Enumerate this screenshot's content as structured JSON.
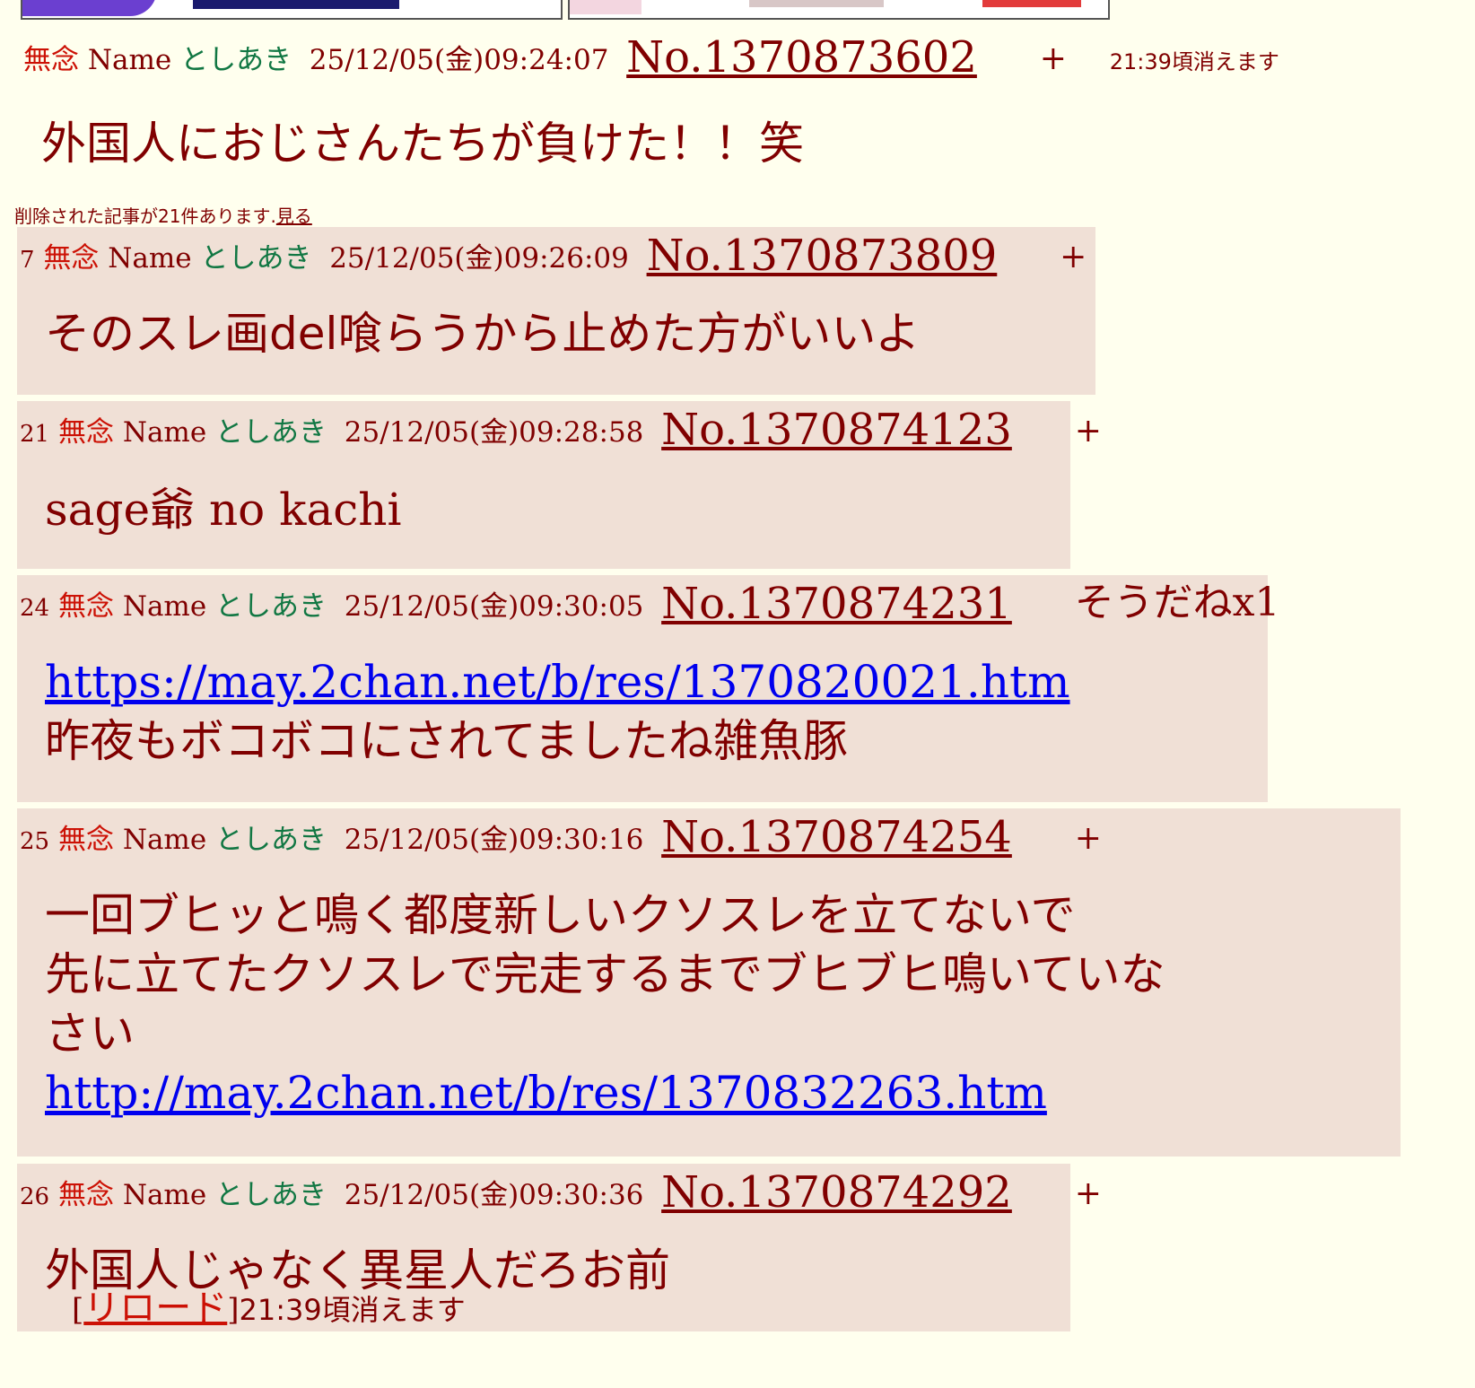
{
  "op": {
    "subject": "無念",
    "name_label": "Name",
    "name": "としあき",
    "datetime": "25/12/05(金)09:24:07",
    "post_no": "No.1370873602",
    "plus": "+",
    "expire_note": "21:39頃消えます",
    "body": "外国人におじさんたちが負けた！！笑"
  },
  "deleted_notice": {
    "text": "削除された記事が21件あります.",
    "link": "見る"
  },
  "replies": [
    {
      "res_num": "7",
      "subject": "無念",
      "name_label": "Name",
      "name": "としあき",
      "datetime": "25/12/05(金)09:26:09",
      "post_no": "No.1370873809",
      "plus": "+",
      "lines": [
        "そのスレ画del喰らうから止めた方がいいよ"
      ]
    },
    {
      "res_num": "21",
      "subject": "無念",
      "name_label": "Name",
      "name": "としあき",
      "datetime": "25/12/05(金)09:28:58",
      "post_no": "No.1370874123",
      "plus": "+",
      "lines": [
        "sage爺 no kachi"
      ]
    },
    {
      "res_num": "24",
      "subject": "無念",
      "name_label": "Name",
      "name": "としあき",
      "datetime": "25/12/05(金)09:30:05",
      "post_no": "No.1370874231",
      "soudane": "そうだねx1",
      "link1": "https://may.2chan.net/b/res/1370820021.htm",
      "lines": [
        "昨夜もボコボコにされてましたね雑魚豚"
      ]
    },
    {
      "res_num": "25",
      "subject": "無念",
      "name_label": "Name",
      "name": "としあき",
      "datetime": "25/12/05(金)09:30:16",
      "post_no": "No.1370874254",
      "plus": "+",
      "lines": [
        "一回ブヒッと鳴く都度新しいクソスレを立てないで",
        "先に立てたクソスレで完走するまでブヒブヒ鳴いていな",
        "さい"
      ],
      "link1": "http://may.2chan.net/b/res/1370832263.htm"
    },
    {
      "res_num": "26",
      "subject": "無念",
      "name_label": "Name",
      "name": "としあき",
      "datetime": "25/12/05(金)09:30:36",
      "post_no": "No.1370874292",
      "plus": "+",
      "lines": [
        "外国人じゃなく異星人だろお前"
      ]
    }
  ],
  "footer": {
    "bracket_open": "[",
    "reload": "リロード",
    "bracket_close": "]",
    "expire": "21:39頃消えます"
  }
}
